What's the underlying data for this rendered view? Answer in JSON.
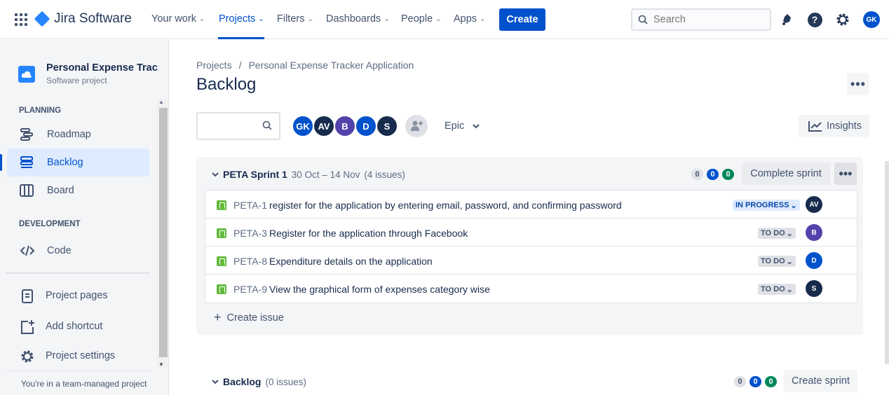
{
  "topnav": {
    "app_name": "Jira Software",
    "items": [
      {
        "label": "Your work"
      },
      {
        "label": "Projects"
      },
      {
        "label": "Filters"
      },
      {
        "label": "Dashboards"
      },
      {
        "label": "People"
      },
      {
        "label": "Apps"
      }
    ],
    "create_label": "Create",
    "search_placeholder": "Search",
    "user_initials": "GK"
  },
  "sidebar": {
    "project_name": "Personal Expense Trac...",
    "project_type": "Software project",
    "planning_label": "PLANNING",
    "planning_items": [
      {
        "label": "Roadmap",
        "icon": "roadmap-icon"
      },
      {
        "label": "Backlog",
        "icon": "backlog-icon"
      },
      {
        "label": "Board",
        "icon": "board-icon"
      }
    ],
    "development_label": "DEVELOPMENT",
    "code_label": "Code",
    "bottom_items": [
      {
        "label": "Project pages",
        "icon": "page-icon"
      },
      {
        "label": "Add shortcut",
        "icon": "add-shortcut-icon"
      },
      {
        "label": "Project settings",
        "icon": "gear-icon"
      }
    ],
    "footer": "You're in a team-managed project"
  },
  "main": {
    "breadcrumb": [
      "Projects",
      "/",
      "Personal Expense Tracker Application"
    ],
    "title": "Backlog",
    "members": [
      {
        "initials": "GK",
        "color": "#0052cc"
      },
      {
        "initials": "AV",
        "color": "#172b4d"
      },
      {
        "initials": "B",
        "color": "#5243aa"
      },
      {
        "initials": "D",
        "color": "#0052cc"
      },
      {
        "initials": "S",
        "color": "#172b4d"
      }
    ],
    "epic_label": "Epic",
    "insights_label": "Insights"
  },
  "sprint": {
    "name": "PETA Sprint 1",
    "dates": "30 Oct – 14 Nov",
    "issue_count": "(4 issues)",
    "counts": {
      "todo": "0",
      "inprogress": "0",
      "done": "0"
    },
    "complete_label": "Complete sprint",
    "issues": [
      {
        "key": "PETA-1",
        "summary": "register for the application by entering email, password, and confirming password",
        "status": "IN PROGRESS",
        "assignee": "AV",
        "assignee_color": "#172b4d"
      },
      {
        "key": "PETA-3",
        "summary": "Register for the application through Facebook",
        "status": "TO DO",
        "assignee": "B",
        "assignee_color": "#5243aa"
      },
      {
        "key": "PETA-8",
        "summary": "Expenditure details on the application",
        "status": "TO DO",
        "assignee": "D",
        "assignee_color": "#0052cc"
      },
      {
        "key": "PETA-9",
        "summary": "View the graphical form of expenses category wise",
        "status": "TO DO",
        "assignee": "S",
        "assignee_color": "#172b4d"
      }
    ],
    "create_issue_label": "Create issue"
  },
  "backlog": {
    "name": "Backlog",
    "issue_count": "(0 issues)",
    "counts": {
      "todo": "0",
      "inprogress": "0",
      "done": "0"
    },
    "create_sprint_label": "Create sprint"
  }
}
